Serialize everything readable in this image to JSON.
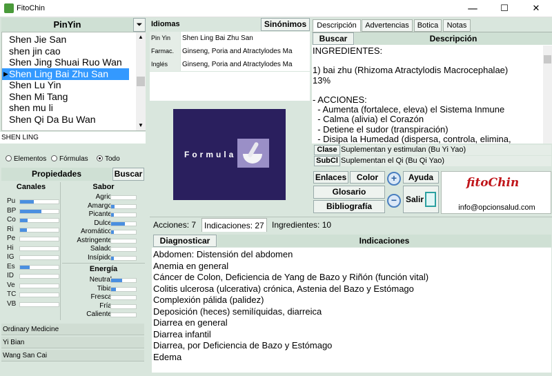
{
  "window": {
    "title": "FitoChin",
    "min": "—",
    "max": "☐",
    "close": "✕"
  },
  "left": {
    "header": "PinYin",
    "list": [
      "Shen Jie San",
      "shen jin cao",
      "Shen Jing Shuai Ruo Wan",
      "Shen Ling Bai Zhu San",
      "Shen Lu Yin",
      "Shen Mi Tang",
      "shen mu li",
      "Shen Qi Da Bu Wan"
    ],
    "selected_index": 3,
    "search_value": "SHEN LING",
    "radios": [
      {
        "label": "Elementos",
        "checked": false
      },
      {
        "label": "Fórmulas",
        "checked": false
      },
      {
        "label": "Todo",
        "checked": true
      }
    ],
    "propiedades": "Propiedades",
    "buscar": "Buscar",
    "canales_title": "Canales",
    "canales": [
      {
        "label": "Pu",
        "value": 0.35
      },
      {
        "label": "BP",
        "value": 0.55
      },
      {
        "label": "Co",
        "value": 0.2
      },
      {
        "label": "Ri",
        "value": 0.18
      },
      {
        "label": "Pe",
        "value": 0
      },
      {
        "label": "Hi",
        "value": 0
      },
      {
        "label": "IG",
        "value": 0
      },
      {
        "label": "Es",
        "value": 0.25
      },
      {
        "label": "ID",
        "value": 0
      },
      {
        "label": "Ve",
        "value": 0
      },
      {
        "label": "TC",
        "value": 0
      },
      {
        "label": "VB",
        "value": 0
      }
    ],
    "sabor_title": "Sabor",
    "sabor": [
      {
        "label": "Agrio",
        "value": 0
      },
      {
        "label": "Amargo",
        "value": 0.15
      },
      {
        "label": "Picante",
        "value": 0.1
      },
      {
        "label": "Dulce",
        "value": 0.55
      },
      {
        "label": "Aromático",
        "value": 0.1
      },
      {
        "label": "Astringente",
        "value": 0
      },
      {
        "label": "Salado",
        "value": 0
      },
      {
        "label": "Insípido",
        "value": 0.1
      }
    ],
    "energia_title": "Energía",
    "energia": [
      {
        "label": "Neutral",
        "value": 0.45
      },
      {
        "label": "Tibia",
        "value": 0.2
      },
      {
        "label": "Fresca",
        "value": 0
      },
      {
        "label": "Fría",
        "value": 0
      },
      {
        "label": "Caliente",
        "value": 0
      }
    ],
    "bottom_items": [
      "Ordinary Medicine",
      "Yi Bian",
      "Wang San Cai"
    ]
  },
  "middle": {
    "idiomas": "Idiomas",
    "sinonimos": "Sinónimos",
    "rows": [
      {
        "label": "Pin Yin",
        "value": "Shen Ling Bai Zhu San"
      },
      {
        "label": "Farmac.",
        "value": "Ginseng, Poria and Atractylodes Ma"
      },
      {
        "label": "Inglés",
        "value": "Ginseng, Poria and Atractylodes Ma"
      }
    ],
    "image_text": "Formula"
  },
  "right": {
    "tabs": [
      "Descripción",
      "Advertencias",
      "Botica",
      "Notas"
    ],
    "active_tab": 0,
    "buscar": "Buscar",
    "descripcion_header": "Descripción",
    "description_lines": [
      "INGREDIENTES:",
      "",
      "1) bai zhu (Rhizoma Atractylodis Macrocephalae)",
      "13%",
      "",
      "- ACCIONES:",
      "  - Aumenta (fortalece, eleva) el Sistema Inmune",
      "  - Calma (alivia) el Corazón",
      "  - Detiene el sudor (transpiración)",
      "  - Disipa la Humedad (dispersa, controla, elimina,"
    ],
    "clase_label": "Clase",
    "clase_value": "Suplementan y estimulan (Bu Yi Yao)",
    "subcl_label": "SubCl",
    "subcl_value": "Suplementan el Qi (Bu Qi Yao)",
    "buttons": {
      "enlaces": "Enlaces",
      "color": "Color",
      "ayuda": "Ayuda",
      "glosario": "Glosario",
      "salir": "Salir",
      "bibliografia": "Bibliografía"
    },
    "logo_text": "fitoChin",
    "logo_email": "info@opcionsalud.com"
  },
  "bottom": {
    "tabs": [
      "Acciones: 7",
      "Indicaciones: 27",
      "Ingredientes: 10"
    ],
    "active_tab": 1,
    "diagnosticar": "Diagnosticar",
    "indicaciones_header": "Indicaciones",
    "indicaciones": [
      "Abdomen: Distensión del abdomen",
      "Anemia en general",
      "Cáncer de Colon, Deficiencia de Yang de Bazo y Riñón (función vital)",
      "Colitis ulcerosa (ulcerativa) crónica, Astenia del Bazo y Estómago",
      "Complexión pálida (palidez)",
      "Deposición (heces) semilíquidas, diarreica",
      "Diarrea en general",
      "Diarrea infantil",
      "Diarrea, por Deficiencia de Bazo y Estómago",
      "Edema"
    ]
  },
  "colors": {
    "background": "#d9e6dd",
    "selection": "#3399ff",
    "bar": "#4a8fe0",
    "image_bg": "#2a1f5e"
  }
}
